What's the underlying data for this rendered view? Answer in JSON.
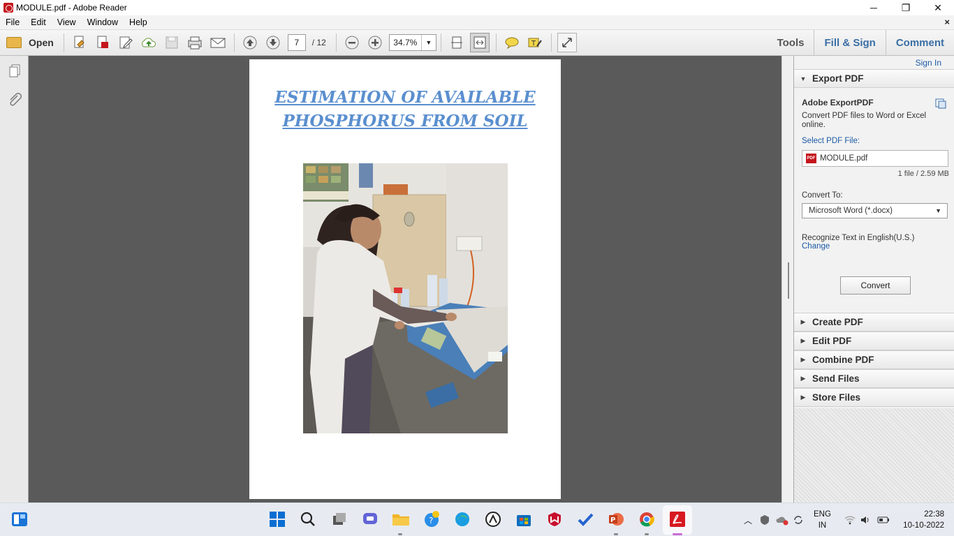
{
  "window": {
    "title": "MODULE.pdf - Adobe Reader",
    "controls": {
      "minimize": "─",
      "restore": "❐",
      "close": "✕"
    }
  },
  "menu": {
    "items": [
      "File",
      "Edit",
      "View",
      "Window",
      "Help"
    ],
    "close_doc": "×"
  },
  "toolbar": {
    "open_label": "Open",
    "page_current": "7",
    "page_total": "/ 12",
    "zoom": "34.7%",
    "tabs": {
      "tools": "Tools",
      "fill_sign": "Fill & Sign",
      "comment": "Comment"
    }
  },
  "document": {
    "title_line1": "ESTIMATION OF AVAILABLE",
    "title_line2": "PHOSPHORUS FROM SOIL"
  },
  "panel": {
    "sign_in": "Sign In",
    "export": {
      "header": "Export PDF",
      "service": "Adobe ExportPDF",
      "description": "Convert PDF files to Word or Excel online.",
      "select_label": "Select PDF File:",
      "file_name": "MODULE.pdf",
      "file_info": "1 file / 2.59 MB",
      "convert_to_label": "Convert To:",
      "convert_to_value": "Microsoft Word (*.docx)",
      "recognize_text": "Recognize Text in English(U.S.)",
      "change_link": "Change",
      "convert_button": "Convert"
    },
    "sections": [
      "Create PDF",
      "Edit PDF",
      "Combine PDF",
      "Send Files",
      "Store Files"
    ]
  },
  "taskbar": {
    "language": "ENG",
    "region": "IN",
    "time": "22:38",
    "date": "10-10-2022"
  },
  "colors": {
    "accent_blue": "#3a6ea5",
    "title_blue": "#5a8fcf",
    "adobe_red": "#c4161c",
    "doc_bg": "#5a5a5a"
  }
}
